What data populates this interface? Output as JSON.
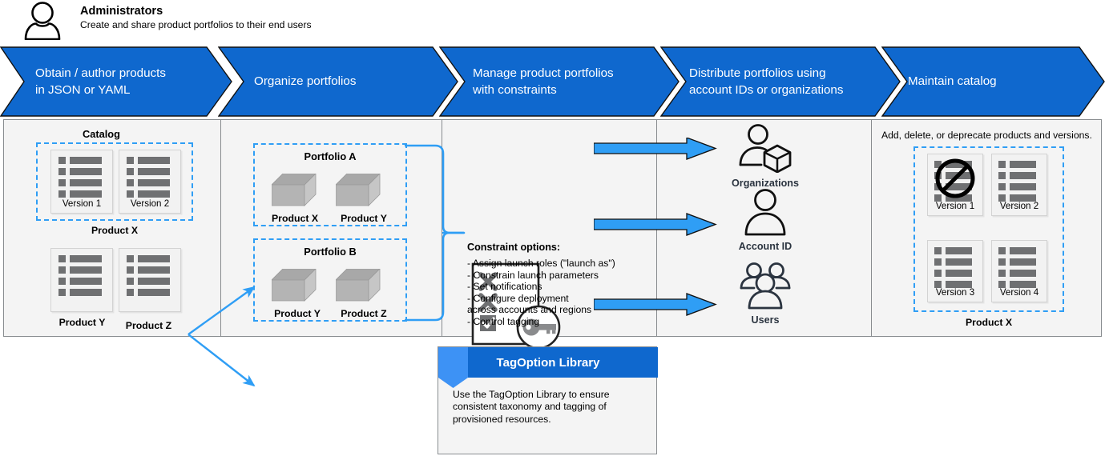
{
  "actor": {
    "icon": "person-icon",
    "title": "Administrators",
    "subtitle": "Create and share product portfolios to their end users"
  },
  "theme": {
    "banner_blue": "#0f68ce",
    "arrow_blue": "#2f9ef5",
    "panel_bg": "#f4f4f4",
    "panel_border": "#888c8f",
    "doc_gray": "#6f7072"
  },
  "banner": {
    "steps": [
      {
        "label": "Obtain / author products\nin JSON or YAML"
      },
      {
        "label": "Organize portfolios"
      },
      {
        "label": "Manage product portfolios\nwith constraints"
      },
      {
        "label": "Distribute portfolios using\naccount IDs or organizations"
      },
      {
        "label": "Maintain catalog"
      }
    ]
  },
  "catalog": {
    "title": "Catalog",
    "group_label": "Product X",
    "versions": [
      {
        "caption": "Version 1"
      },
      {
        "caption": "Version 2"
      }
    ],
    "other_products": [
      {
        "caption": "",
        "label": "Product  Y"
      },
      {
        "caption": "",
        "label": "Product  Z"
      }
    ]
  },
  "portfolios": {
    "groups": [
      {
        "title": "Portfolio A",
        "products": [
          "Product X",
          "Product  Y"
        ]
      },
      {
        "title": "Portfolio B",
        "products": [
          "Product  Y",
          "Product  Z"
        ]
      }
    ]
  },
  "constraints": {
    "icon": "checklist-key-icon",
    "heading": "Constraint options:",
    "options": "- Assign launch roles (\"launch as\")\n- Constrain launch parameters\n- Set notifications\n- Configure deployment\n  across accounts and regions\n- Control tagging"
  },
  "distribute": {
    "targets": [
      {
        "icon": "organization-user-icon",
        "label": "Organizations"
      },
      {
        "icon": "user-icon",
        "label": "Account ID"
      },
      {
        "icon": "users-group-icon",
        "label": "Users"
      }
    ]
  },
  "maintain": {
    "note": "Add, delete, or deprecate products and versions.",
    "group_label": "Product X",
    "versions": [
      {
        "caption": "Version 1",
        "deprecated": true
      },
      {
        "caption": "Version 2",
        "deprecated": false
      },
      {
        "caption": "Version 3",
        "deprecated": false
      },
      {
        "caption": "Version 4",
        "deprecated": false
      }
    ]
  },
  "tagoption": {
    "title": "TagOption Library",
    "body": "Use the TagOption Library to ensure\nconsistent taxonomy and tagging of\nprovisioned resources."
  }
}
